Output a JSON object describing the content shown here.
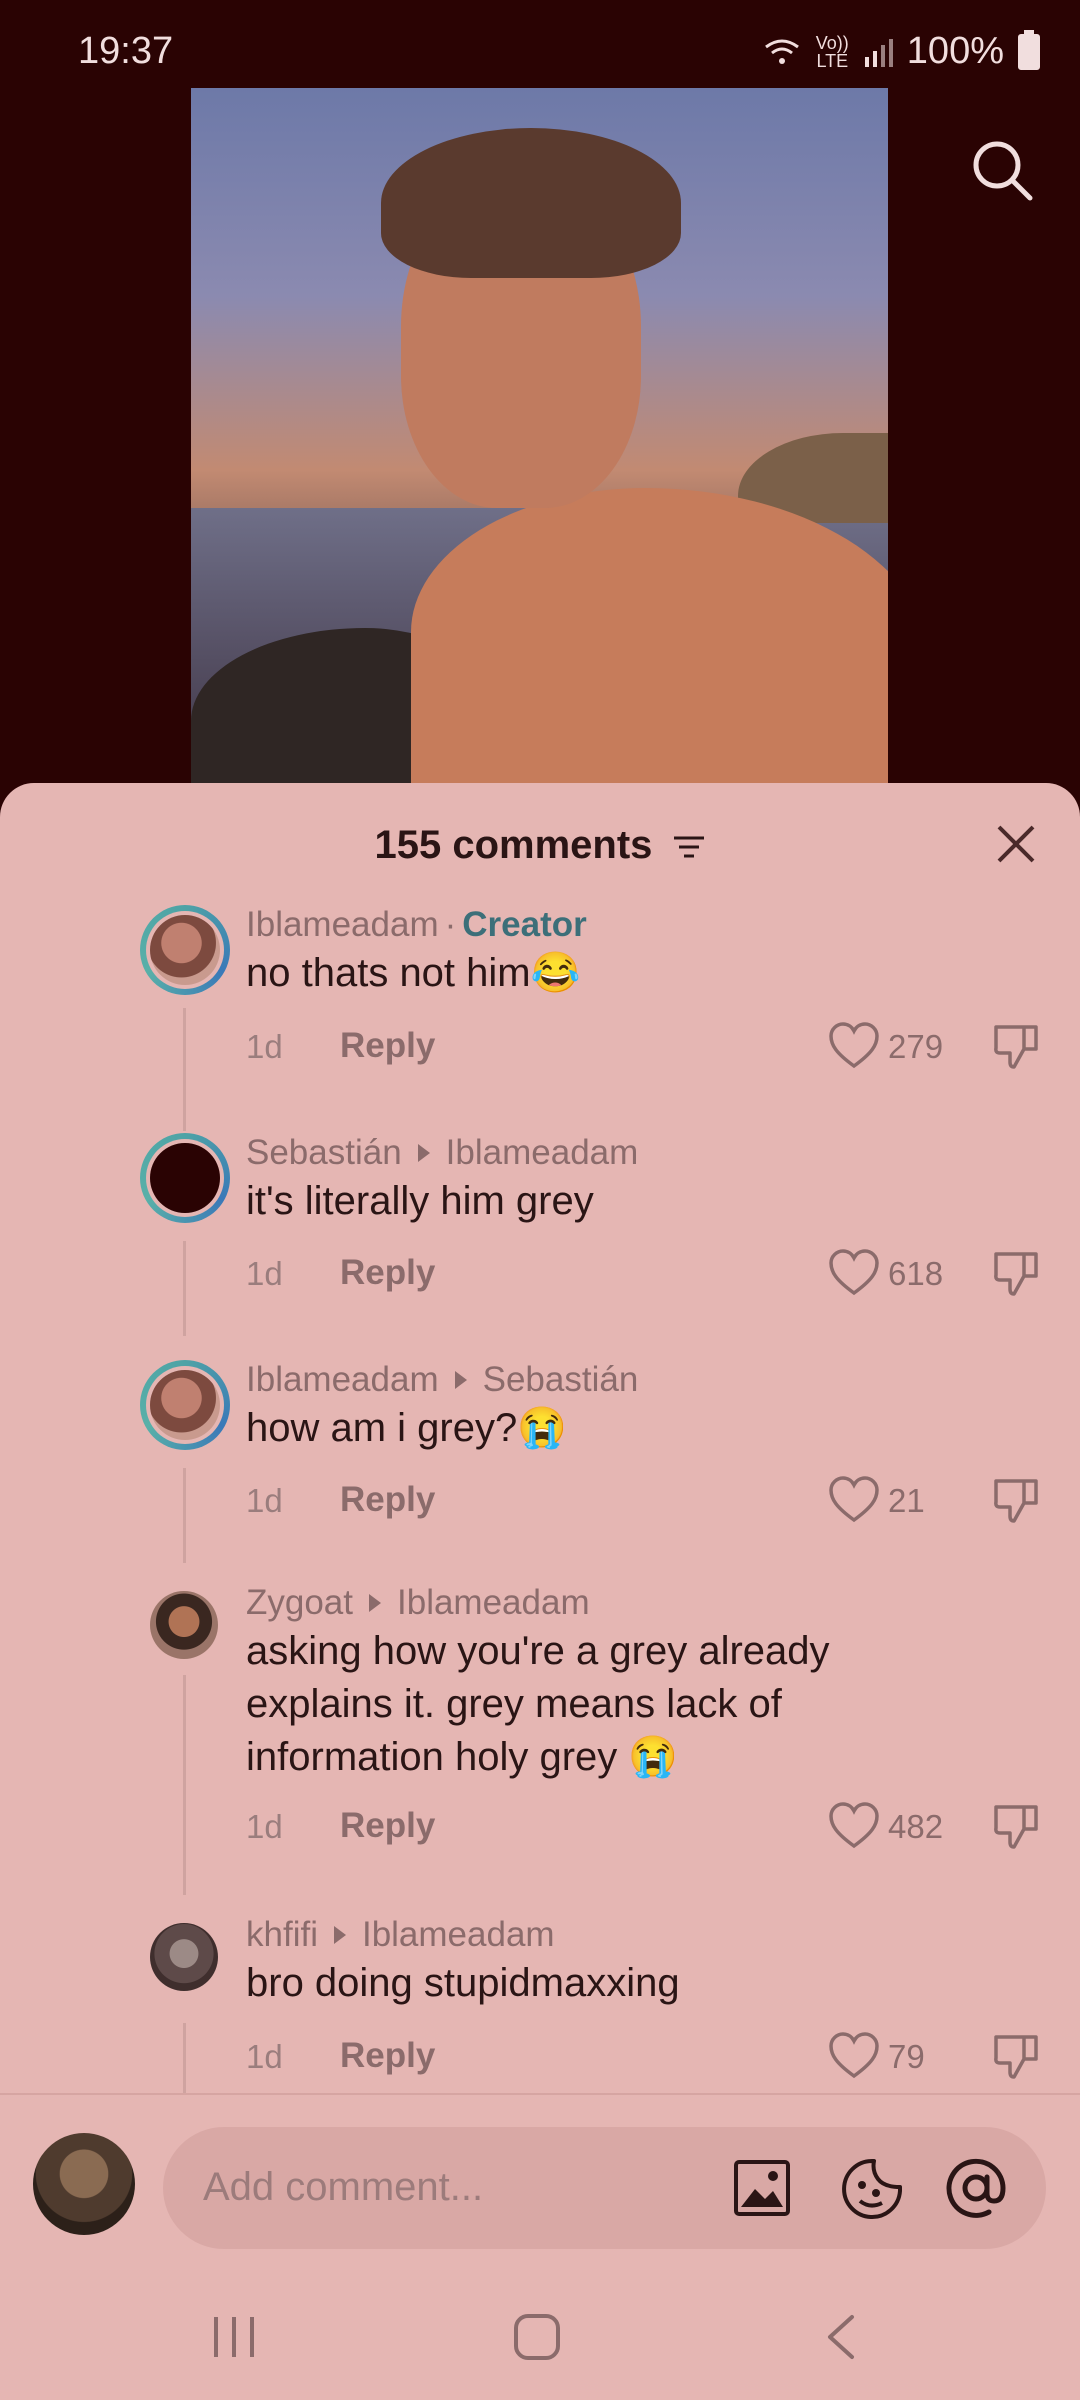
{
  "status_bar": {
    "time": "19:37",
    "net_small_top": "Vo))",
    "net_small_bottom": "LTE",
    "battery": "100%"
  },
  "sheet": {
    "title": "155 comments"
  },
  "comments": [
    {
      "user": "Iblameadam",
      "badge": "Creator",
      "reply_to": "",
      "text": "no thats not him😂",
      "time": "1d",
      "reply": "Reply",
      "likes": "279"
    },
    {
      "user": "Sebastián",
      "badge": "",
      "reply_to": "Iblameadam",
      "text": "it's literally him grey",
      "time": "1d",
      "reply": "Reply",
      "likes": "618"
    },
    {
      "user": "Iblameadam",
      "badge": "",
      "reply_to": "Sebastián",
      "text": "how am i grey?😭",
      "time": "1d",
      "reply": "Reply",
      "likes": "21"
    },
    {
      "user": "Zygoat",
      "badge": "",
      "reply_to": "Iblameadam",
      "text": "asking how you're a grey already explains it. grey means lack of information holy grey 😭",
      "time": "1d",
      "reply": "Reply",
      "likes": "482"
    },
    {
      "user": "khfifi",
      "badge": "",
      "reply_to": "Iblameadam",
      "text": "bro doing stupidmaxxing",
      "time": "1d",
      "reply": "Reply",
      "likes": "79"
    }
  ],
  "composer": {
    "placeholder": "Add comment..."
  }
}
